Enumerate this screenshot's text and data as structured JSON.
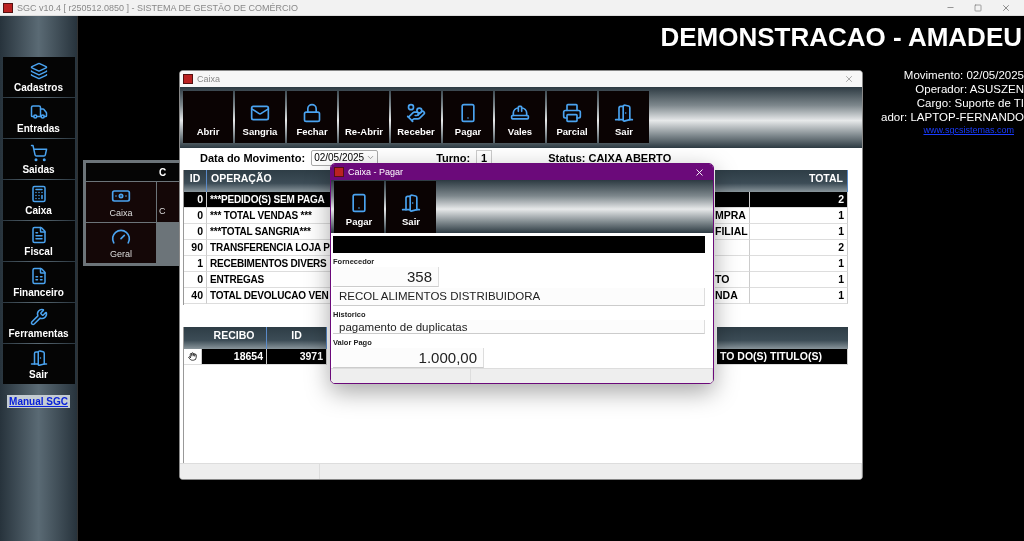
{
  "window": {
    "title": "SGC v10.4 [ r250512.0850 ] - SISTEMA DE GESTÃO DE COMÉRCIO"
  },
  "sidebar": {
    "items": [
      {
        "label": "Cadastros"
      },
      {
        "label": "Entradas"
      },
      {
        "label": "Saidas"
      },
      {
        "label": "Caixa"
      },
      {
        "label": "Fiscal"
      },
      {
        "label": "Financeiro"
      },
      {
        "label": "Ferramentas"
      },
      {
        "label": "Sair"
      }
    ],
    "link": "Manual SGC"
  },
  "header": {
    "company": "DEMONSTRACAO - AMADEU",
    "info": [
      "Movimento: 02/05/2025",
      "Operador: ASUSZEN",
      "Cargo: Suporte de TI",
      "ador: LAPTOP-FERNANDO"
    ],
    "link": "www.sgcsistemas.com"
  },
  "submenu": {
    "title": "C",
    "items": [
      {
        "label": "Caixa"
      },
      {
        "label": "C"
      },
      {
        "label": "Geral"
      }
    ]
  },
  "caixa_window": {
    "title": "Caixa",
    "toolbar": [
      {
        "label": "Abrir"
      },
      {
        "label": "Sangria"
      },
      {
        "label": "Fechar"
      },
      {
        "label": "Re-Abrir"
      },
      {
        "label": "Receber"
      },
      {
        "label": "Pagar"
      },
      {
        "label": "Vales"
      },
      {
        "label": "Parcial"
      },
      {
        "label": "Sair"
      }
    ],
    "date_label": "Data do Movimento:",
    "date": "02/05/2025",
    "turno_label": "Turno:",
    "turno": "1",
    "status": "Status: CAIXA ABERTO",
    "upper_table": {
      "columns": [
        "ID",
        "OPERAÇÃO",
        "TOTAL"
      ],
      "rows": [
        {
          "id": "0",
          "operation": "***PEDIDO(S) SEM PAGA",
          "column_3": "",
          "total": "2",
          "selected": true
        },
        {
          "id": "0",
          "operation": "*** TOTAL VENDAS ***",
          "column_3": "MPRA",
          "total": "1",
          "selected": false
        },
        {
          "id": "0",
          "operation": "***TOTAL SANGRIA***",
          "column_3": "FILIAL",
          "total": "1",
          "selected": false
        },
        {
          "id": "90",
          "operation": "TRANSFERENCIA LOJA P",
          "column_3": "",
          "total": "2",
          "selected": false
        },
        {
          "id": "1",
          "operation": "RECEBIMENTOS DIVERS",
          "column_3": "",
          "total": "1",
          "selected": false
        },
        {
          "id": "0",
          "operation": "ENTREGAS",
          "column_3": "TO",
          "total": "1",
          "selected": false
        },
        {
          "id": "40",
          "operation": "TOTAL DEVOLUCAO VEN",
          "column_3": "NDA",
          "total": "1",
          "selected": false
        }
      ]
    },
    "lower_table": {
      "columns": [
        "RECIBO",
        "ID"
      ],
      "rows": [
        {
          "recibo": "18654",
          "id": "3971",
          "column_4": "TO DO(S) TITULO(S)",
          "selected": true
        }
      ]
    }
  },
  "dialog": {
    "title": "Caixa - Pagar",
    "toolbar": [
      {
        "label": "Pagar"
      },
      {
        "label": "Sair"
      }
    ],
    "fornecedor_label": "Fornecedor",
    "fornecedor_code": "358",
    "fornecedor_name": "RECOL ALIMENTOS DISTRIBUIDORA",
    "historico_label": "Historico",
    "historico": "pagamento de duplicatas",
    "valor_label": "Valor Pago",
    "valor": "1.000,00"
  }
}
